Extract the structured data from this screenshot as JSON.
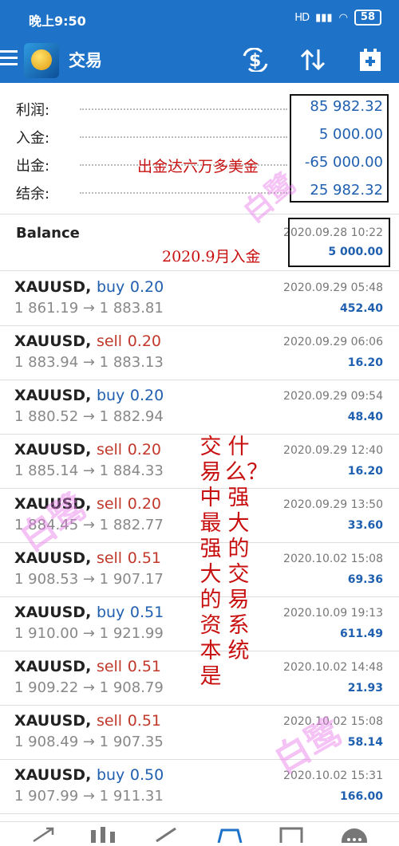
{
  "status_bar": {
    "time": "晚上9:50",
    "signal": "HD",
    "battery": "58"
  },
  "app_bar": {
    "title": "交易",
    "icons": [
      "menu-icon",
      "app-logo",
      "currency-exchange-icon",
      "sort-icon",
      "add-calendar-icon"
    ]
  },
  "summary": {
    "rows": [
      {
        "label": "利润:",
        "value": "85 982.32"
      },
      {
        "label": "入金:",
        "value": "5 000.00"
      },
      {
        "label": "出金:",
        "value": "-65 000.00"
      },
      {
        "label": "结余:",
        "value": "25 982.32"
      }
    ]
  },
  "balance": {
    "title": "Balance",
    "date": "2020.09.28 10:22",
    "amount": "5 000.00"
  },
  "annotations": {
    "withdraw_note": "出金达六万多美金",
    "deposit_note": "2020.9月入金",
    "col_left": "交易中最强大的资本是",
    "col_right": "什么？强大的交易系统",
    "watermark": "白鹭"
  },
  "trades": [
    {
      "symbol": "XAUUSD,",
      "side": "buy",
      "lots": "0.20",
      "prices": "1 861.19 → 1 883.81",
      "date": "2020.09.29 05:48",
      "profit": "452.40"
    },
    {
      "symbol": "XAUUSD,",
      "side": "sell",
      "lots": "0.20",
      "prices": "1 883.94 → 1 883.13",
      "date": "2020.09.29 06:06",
      "profit": "16.20"
    },
    {
      "symbol": "XAUUSD,",
      "side": "buy",
      "lots": "0.20",
      "prices": "1 880.52 → 1 882.94",
      "date": "2020.09.29 09:54",
      "profit": "48.40"
    },
    {
      "symbol": "XAUUSD,",
      "side": "sell",
      "lots": "0.20",
      "prices": "1 885.14 → 1 884.33",
      "date": "2020.09.29 12:40",
      "profit": "16.20"
    },
    {
      "symbol": "XAUUSD,",
      "side": "sell",
      "lots": "0.20",
      "prices": "1 884.45 → 1 882.77",
      "date": "2020.09.29 13:50",
      "profit": "33.60"
    },
    {
      "symbol": "XAUUSD,",
      "side": "sell",
      "lots": "0.51",
      "prices": "1 908.53 → 1 907.17",
      "date": "2020.10.02 15:08",
      "profit": "69.36"
    },
    {
      "symbol": "XAUUSD,",
      "side": "buy",
      "lots": "0.51",
      "prices": "1 910.00 → 1 921.99",
      "date": "2020.10.09 19:13",
      "profit": "611.49"
    },
    {
      "symbol": "XAUUSD,",
      "side": "sell",
      "lots": "0.51",
      "prices": "1 909.22 → 1 908.79",
      "date": "2020.10.02 14:48",
      "profit": "21.93"
    },
    {
      "symbol": "XAUUSD,",
      "side": "sell",
      "lots": "0.51",
      "prices": "1 908.49 → 1 907.35",
      "date": "2020.10.02 15:08",
      "profit": "58.14"
    },
    {
      "symbol": "XAUUSD,",
      "side": "buy",
      "lots": "0.50",
      "prices": "1 907.99 → 1 911.31",
      "date": "2020.10.02 15:31",
      "profit": "166.00"
    }
  ],
  "bottom_nav": [
    "quotes-icon",
    "chart-icon",
    "trade-icon",
    "history-icon",
    "news-icon",
    "chat-icon"
  ],
  "colors": {
    "primary": "#1e73c8",
    "value_blue": "#1f5fb0",
    "sell_red": "#c0392b",
    "annotation_red": "#c81010"
  }
}
